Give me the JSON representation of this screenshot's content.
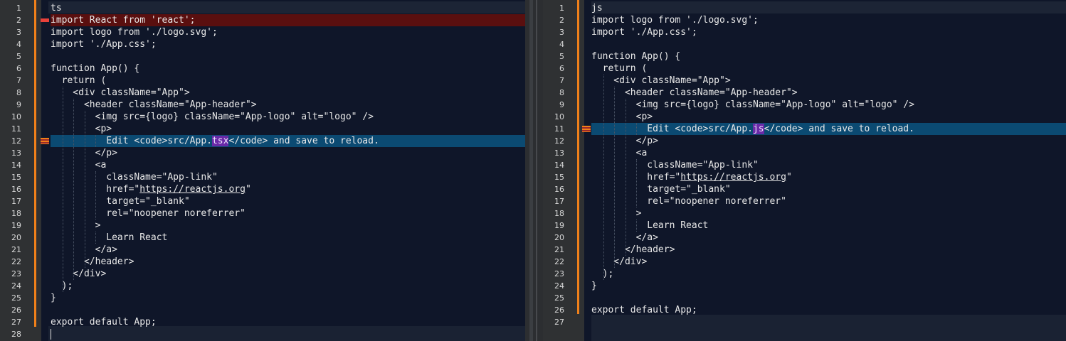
{
  "left": {
    "language_tag": "ts",
    "lines": [
      {
        "n": "1",
        "text": "ts"
      },
      {
        "n": "2",
        "text": "import React from 'react';"
      },
      {
        "n": "3",
        "text": "import logo from './logo.svg';"
      },
      {
        "n": "4",
        "text": "import './App.css';"
      },
      {
        "n": "5",
        "text": ""
      },
      {
        "n": "6",
        "text": "function App() {"
      },
      {
        "n": "7",
        "text": "  return ("
      },
      {
        "n": "8",
        "text": "    <div className=\"App\">"
      },
      {
        "n": "9",
        "text": "      <header className=\"App-header\">"
      },
      {
        "n": "10",
        "text": "        <img src={logo} className=\"App-logo\" alt=\"logo\" />"
      },
      {
        "n": "11",
        "text": "        <p>"
      },
      {
        "n": "12",
        "text_pre": "          Edit <code>src/App.",
        "text_hl": "tsx",
        "text_post": "</code> and save to reload."
      },
      {
        "n": "13",
        "text": "        </p>"
      },
      {
        "n": "14",
        "text": "        <a"
      },
      {
        "n": "15",
        "text": "          className=\"App-link\""
      },
      {
        "n": "16",
        "text_pre": "          href=\"",
        "text_link": "https://reactjs.org",
        "text_post": "\""
      },
      {
        "n": "17",
        "text": "          target=\"_blank\""
      },
      {
        "n": "18",
        "text": "          rel=\"noopener noreferrer\""
      },
      {
        "n": "19",
        "text": "        >"
      },
      {
        "n": "20",
        "text": "          Learn React"
      },
      {
        "n": "21",
        "text": "        </a>"
      },
      {
        "n": "22",
        "text": "      </header>"
      },
      {
        "n": "23",
        "text": "    </div>"
      },
      {
        "n": "24",
        "text": "  );"
      },
      {
        "n": "25",
        "text": "}"
      },
      {
        "n": "26",
        "text": ""
      },
      {
        "n": "27",
        "text": "export default App;"
      },
      {
        "n": "28",
        "text": ""
      }
    ]
  },
  "right": {
    "language_tag": "js",
    "lines": [
      {
        "n": "1",
        "text": "js"
      },
      {
        "n": "2",
        "text": "import logo from './logo.svg';"
      },
      {
        "n": "3",
        "text": "import './App.css';"
      },
      {
        "n": "4",
        "text": ""
      },
      {
        "n": "5",
        "text": "function App() {"
      },
      {
        "n": "6",
        "text": "  return ("
      },
      {
        "n": "7",
        "text": "    <div className=\"App\">"
      },
      {
        "n": "8",
        "text": "      <header className=\"App-header\">"
      },
      {
        "n": "9",
        "text": "        <img src={logo} className=\"App-logo\" alt=\"logo\" />"
      },
      {
        "n": "10",
        "text": "        <p>"
      },
      {
        "n": "11",
        "text_pre": "          Edit <code>src/App.",
        "text_hl": "js",
        "text_post": "</code> and save to reload."
      },
      {
        "n": "12",
        "text": "        </p>"
      },
      {
        "n": "13",
        "text": "        <a"
      },
      {
        "n": "14",
        "text": "          className=\"App-link\""
      },
      {
        "n": "15",
        "text_pre": "          href=\"",
        "text_link": "https://reactjs.org",
        "text_post": "\""
      },
      {
        "n": "16",
        "text": "          target=\"_blank\""
      },
      {
        "n": "17",
        "text": "          rel=\"noopener noreferrer\""
      },
      {
        "n": "18",
        "text": "        >"
      },
      {
        "n": "19",
        "text": "          Learn React"
      },
      {
        "n": "20",
        "text": "        </a>"
      },
      {
        "n": "21",
        "text": "      </header>"
      },
      {
        "n": "22",
        "text": "    </div>"
      },
      {
        "n": "23",
        "text": "  );"
      },
      {
        "n": "24",
        "text": "}"
      },
      {
        "n": "25",
        "text": ""
      },
      {
        "n": "26",
        "text": "export default App;"
      },
      {
        "n": "27",
        "text": ""
      }
    ]
  },
  "colors": {
    "editor_bg": "#0f1629",
    "deleted_line": "#5a0f0f",
    "changed_line": "#0b4a72",
    "inline_change": "#6a2aa8",
    "gutter_change_stripe": "#f0801a"
  },
  "icons": {
    "deleted_marker": "diff-deleted-icon",
    "changed_marker": "diff-changed-icon"
  }
}
